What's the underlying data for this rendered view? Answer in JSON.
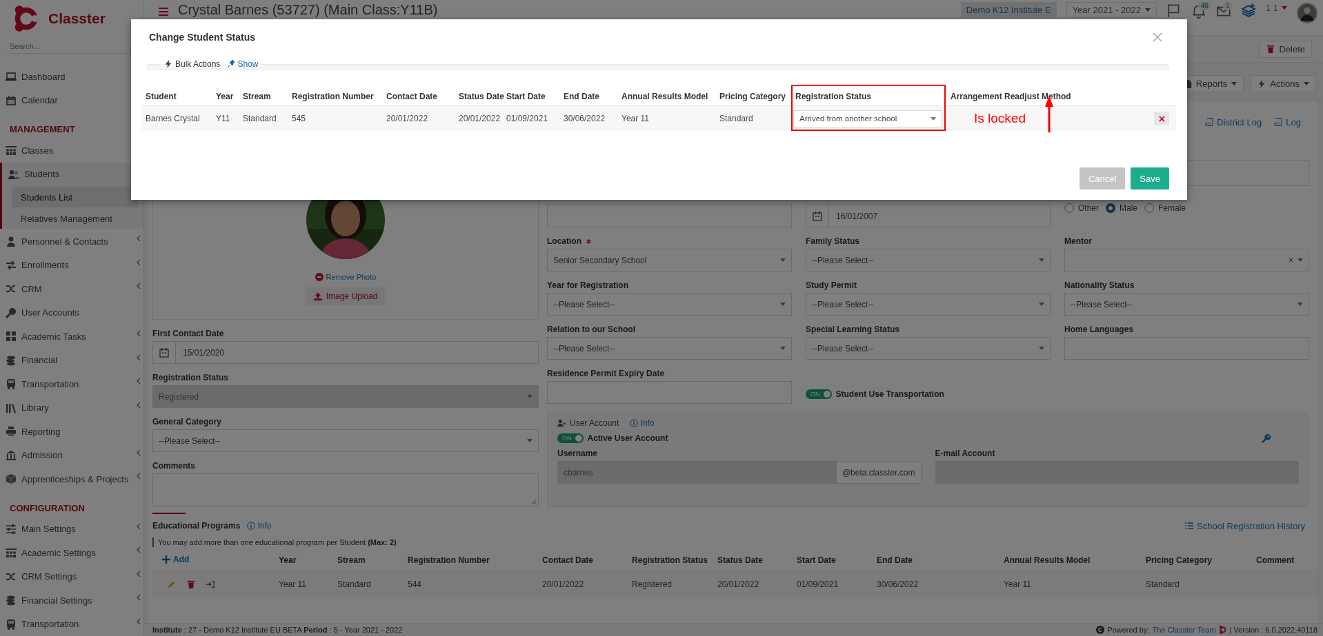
{
  "sidebar": {
    "logo": "Classter",
    "search_placeholder": "Search...",
    "entries": [
      {
        "kind": "link",
        "label": "Dashboard",
        "submenu": false
      },
      {
        "kind": "link",
        "label": "Calendar",
        "submenu": false
      },
      {
        "kind": "heading",
        "label": "MANAGEMENT"
      },
      {
        "kind": "link",
        "label": "Classes",
        "submenu": false
      },
      {
        "kind": "group",
        "label": "Students",
        "expanded": true,
        "children": [
          {
            "label": "Students List",
            "selected": true
          },
          {
            "label": "Relatives Management",
            "selected": false
          }
        ]
      },
      {
        "kind": "link",
        "label": "Personnel & Contacts",
        "submenu": true
      },
      {
        "kind": "link",
        "label": "Enrollments",
        "submenu": true
      },
      {
        "kind": "link",
        "label": "CRM",
        "submenu": true
      },
      {
        "kind": "link",
        "label": "User Accounts",
        "submenu": false
      },
      {
        "kind": "link",
        "label": "Academic Tasks",
        "submenu": true
      },
      {
        "kind": "link",
        "label": "Financial",
        "submenu": true
      },
      {
        "kind": "link",
        "label": "Transportation",
        "submenu": true
      },
      {
        "kind": "link",
        "label": "Library",
        "submenu": true
      },
      {
        "kind": "link",
        "label": "Reporting",
        "submenu": false
      },
      {
        "kind": "link",
        "label": "Admission",
        "submenu": true
      },
      {
        "kind": "link",
        "label": "Apprenticeships & Projects",
        "submenu": true
      },
      {
        "kind": "heading",
        "label": "CONFIGURATION"
      },
      {
        "kind": "link",
        "label": "Main Settings",
        "submenu": true
      },
      {
        "kind": "link",
        "label": "Academic Settings",
        "submenu": true
      },
      {
        "kind": "link",
        "label": "CRM Settings",
        "submenu": true
      },
      {
        "kind": "link",
        "label": "Financial Settings",
        "submenu": true
      },
      {
        "kind": "link",
        "label": "Transportation",
        "submenu": true
      }
    ]
  },
  "header": {
    "title": "Crystal Barnes (53727) (Main Class:Y11B)",
    "institute": "Demo K12 Institute E",
    "year": "Year 2021 - 2022",
    "notifications": "45",
    "messages": "1",
    "user": "1 1"
  },
  "toolbar": {
    "delete": "Delete",
    "reports": "Reports",
    "actions": "Actions",
    "district_log": "District Log",
    "log": "Log"
  },
  "profile": {
    "remove_photo": "Remove Photo",
    "image_upload": "Image Upload"
  },
  "form": {
    "columns": [
      [
        {
          "kind": "date",
          "label": "First Contact Date",
          "value": "15/01/2020",
          "required": false,
          "disabled": false
        },
        {
          "kind": "select",
          "label": "Registration Status",
          "value": "Registered",
          "required": false,
          "disabled": true
        },
        {
          "kind": "select",
          "label": "General Category",
          "value": "--Please Select--",
          "required": false,
          "disabled": false
        },
        {
          "kind": "textarea",
          "label": "Comments",
          "required": false,
          "disabled": false
        }
      ],
      [
        {
          "kind": "input",
          "disabled": false
        },
        {
          "kind": "select",
          "label": "Location",
          "value": "Senior Secondary School",
          "required": true,
          "disabled": false
        },
        {
          "kind": "select",
          "label": "Year for Registration",
          "value": "--Please Select--",
          "required": false,
          "disabled": false
        },
        {
          "kind": "select",
          "label": "Relation to our School",
          "value": "--Please Select--",
          "required": false,
          "disabled": false
        },
        {
          "kind": "input",
          "label": "Residence Permit Expiry Date",
          "required": false,
          "disabled": false
        }
      ],
      [
        {
          "kind": "date",
          "value": "16/01/2007",
          "disabled": false
        },
        {
          "kind": "select",
          "label": "Family Status",
          "value": "--Please Select--",
          "required": false,
          "disabled": false
        },
        {
          "kind": "select",
          "label": "Study Permit",
          "value": "--Please Select--",
          "required": false,
          "disabled": false
        },
        {
          "kind": "select",
          "label": "Special Learning Status",
          "value": "--Please Select--",
          "required": false,
          "disabled": false
        },
        {
          "kind": "toggle",
          "label": "Student Use Transportation",
          "state_text": "ON",
          "on": true
        }
      ],
      [
        {
          "kind": "input",
          "disabled": false
        },
        {
          "kind": "radio",
          "options": [
            {
              "label": "Other",
              "selected": false
            },
            {
              "label": "Male",
              "selected": true
            },
            {
              "label": "Female",
              "selected": false
            }
          ]
        },
        {
          "kind": "select",
          "label": "Mentor",
          "clear": "×",
          "required": false,
          "disabled": false
        },
        {
          "kind": "select",
          "label": "Nationality Status",
          "value": "--Please Select--",
          "required": false,
          "disabled": false
        },
        {
          "kind": "input",
          "label": "Home Languages",
          "required": false,
          "disabled": false
        }
      ]
    ]
  },
  "user_account": {
    "title": "User Account",
    "info": "Info",
    "toggle": {
      "label": "Active User Account",
      "state_text": "ON",
      "on": true
    },
    "username_label": "Username",
    "username": "cbarnes",
    "domain": "@beta.classter.com",
    "email_label": "E-mail Account"
  },
  "programs": {
    "title": "Educational Programs",
    "info": "Info",
    "history": "School Registration History",
    "note": "You may add more than one educational program per Student **(Max: 2)**",
    "add": "Add",
    "columns": [
      "Year",
      "Stream",
      "Registration Number",
      "Contact Date",
      "Registration Status",
      "Status Date",
      "Start Date",
      "End Date",
      "Annual Results Model",
      "Pricing Category",
      "Comment"
    ],
    "rows": [
      {
        "cells": [
          "Year 11",
          "Standard",
          "544",
          "20/01/2022",
          "Registered",
          "20/01/2022",
          "01/09/2021",
          "30/06/2022",
          "Year 11",
          "Standard"
        ]
      }
    ]
  },
  "footer": {
    "info": "**Institute** : 27 - Demo K12 Institute EU BETA **Period** : 5 - Year 2021 - 2022",
    "powered_by": "Powered by:",
    "team": "The Classter Team",
    "version": "| Version : 6.0.2022.40118"
  },
  "modal": {
    "title": "Change Student Status",
    "bulk_actions": "Bulk Actions",
    "show": "Show",
    "columns": [
      "Student",
      "Year",
      "Stream",
      "Registration Number",
      "Contact Date",
      "Status Date",
      "Start Date",
      "End Date",
      "Annual Results Model",
      "Pricing Category",
      "Registration Status",
      "Arrangement Readjust Method"
    ],
    "rows": [
      {
        "cells": [
          "Barnes Crystal",
          "Y11",
          "Standard",
          "545",
          "20/01/2022",
          "20/01/2022",
          "01/09/2021",
          "30/06/2022",
          "Year 11",
          "Standard"
        ],
        "registration_status": "Arrived from another school",
        "note": "Is locked"
      }
    ],
    "cancel": "Cancel",
    "save": "Save"
  }
}
